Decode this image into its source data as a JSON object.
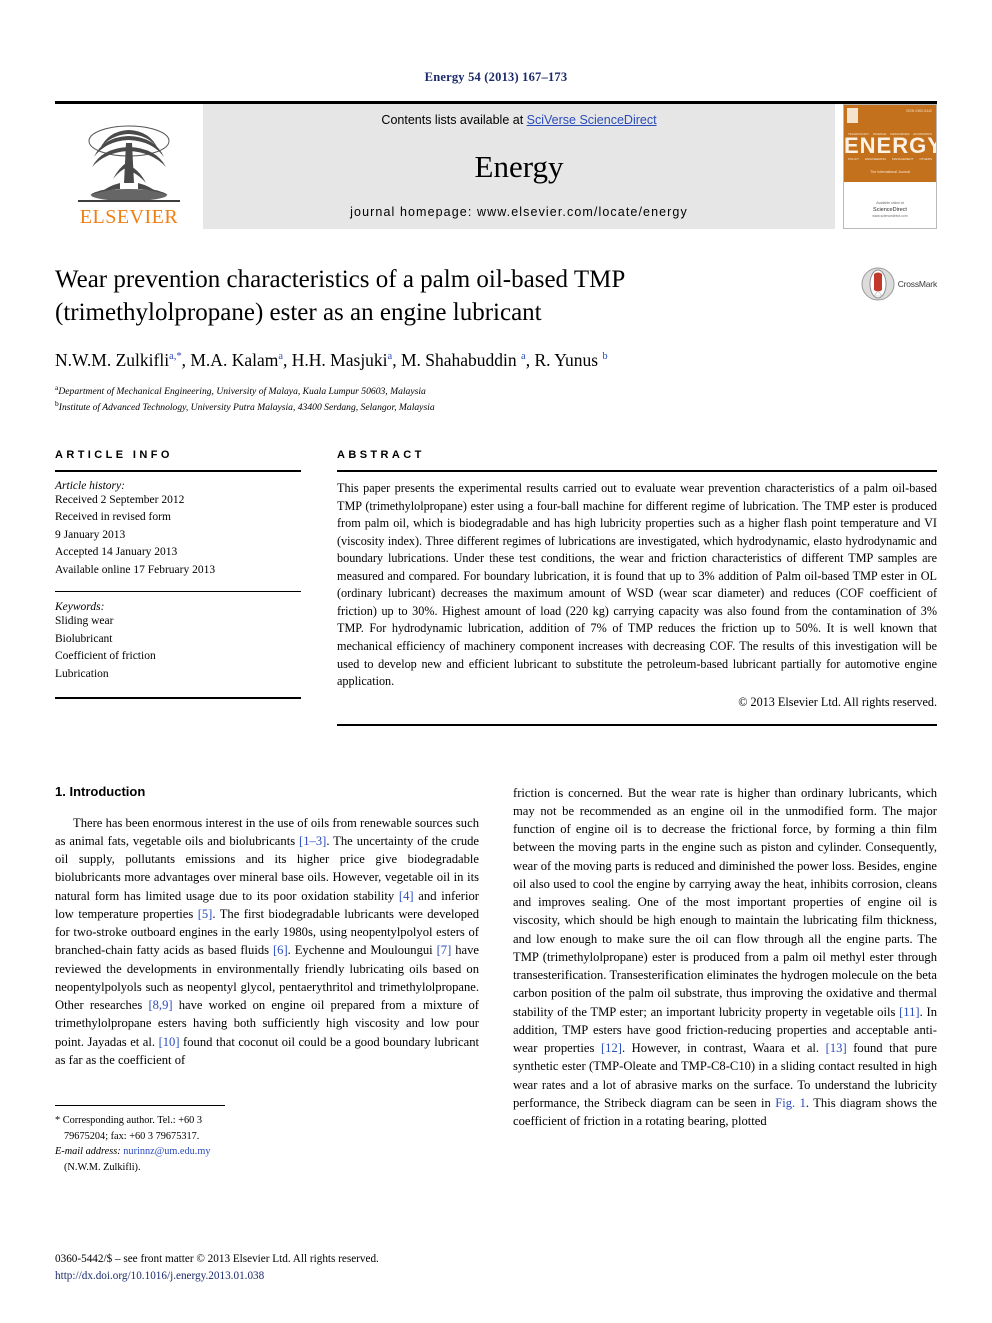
{
  "running_head": "Energy 54 (2013) 167–173",
  "banner": {
    "publisher": "ELSEVIER",
    "contents_prefix": "Contents lists available at ",
    "contents_link": "SciVerse ScienceDirect",
    "journal_name": "Energy",
    "homepage": "journal homepage: www.elsevier.com/locate/energy",
    "cover": {
      "title": "ENERGY",
      "code": "ISSN 0360-5442",
      "subtitle": "The International Journal",
      "keywords_row1": [
        "TECHNOLOGY",
        "SCIENCE",
        "RESOURCES",
        "ECONOMICS"
      ],
      "keywords_row2": [
        "POLICY",
        "ENGINEERING",
        "MANAGEMENT",
        "OTHERS"
      ],
      "sd_small": "Available online at",
      "sd_big": "ScienceDirect",
      "sd_url": "www.sciencedirect.com"
    },
    "link_color": "#2a4bbd"
  },
  "article": {
    "title": "Wear prevention characteristics of a palm oil-based TMP (trimethylolpropane) ester as an engine lubricant",
    "authors_html": "N.W.M. Zulkifli<sup class=\"aff-mark\">a,*</sup>, M.A. Kalam<sup class=\"aff-mark\">a</sup>, H.H. Masjuki<sup class=\"aff-mark\">a</sup>, M. Shahabuddin <sup class=\"aff-mark\">a</sup>, R. Yunus <sup class=\"aff-mark\">b</sup>",
    "affiliation_a": "Department of Mechanical Engineering, University of Malaya, Kuala Lumpur 50603, Malaysia",
    "affiliation_b": "Institute of Advanced Technology, University Putra Malaysia, 43400 Serdang, Selangor, Malaysia",
    "crossmark_label": "CrossMark"
  },
  "article_info": {
    "heading": "ARTICLE INFO",
    "history_label": "Article history:",
    "history": [
      "Received 2 September 2012",
      "Received in revised form",
      "9 January 2013",
      "Accepted 14 January 2013",
      "Available online 17 February 2013"
    ],
    "keywords_label": "Keywords:",
    "keywords": [
      "Sliding wear",
      "Biolubricant",
      "Coefficient of friction",
      "Lubrication"
    ]
  },
  "abstract": {
    "heading": "ABSTRACT",
    "text": "This paper presents the experimental results carried out to evaluate wear prevention characteristics of a palm oil-based TMP (trimethylolpropane) ester using a four-ball machine for different regime of lubrication. The TMP ester is produced from palm oil, which is biodegradable and has high lubricity properties such as a higher flash point temperature and VI (viscosity index). Three different regimes of lubrications are investigated, which hydrodynamic, elasto hydrodynamic and boundary lubrications. Under these test conditions, the wear and friction characteristics of different TMP samples are measured and compared. For boundary lubrication, it is found that up to 3% addition of Palm oil-based TMP ester in OL (ordinary lubricant) decreases the maximum amount of WSD (wear scar diameter) and reduces (COF coefficient of friction) up to 30%. Highest amount of load (220 kg) carrying capacity was also found from the contamination of 3% TMP. For hydrodynamic lubrication, addition of 7% of TMP reduces the friction up to 50%. It is well known that mechanical efficiency of machinery component increases with decreasing COF. The results of this investigation will be used to develop new and efficient lubricant to substitute the petroleum-based lubricant partially for automotive engine application.",
    "copyright": "© 2013 Elsevier Ltd. All rights reserved."
  },
  "introduction": {
    "heading": "1. Introduction",
    "left_paragraph_html": "There has been enormous interest in the use of oils from renewable sources such as animal fats, vegetable oils and biolubricants <span class=\"ref\">[1–3]</span>. The uncertainty of the crude oil supply, pollutants emissions and its higher price give biodegradable biolubricants more advantages over mineral base oils. However, vegetable oil in its natural form has limited usage due to its poor oxidation stability <span class=\"ref\">[4]</span> and inferior low temperature properties <span class=\"ref\">[5]</span>. The first biodegradable lubricants were developed for two-stroke outboard engines in the early 1980s, using neopentylpolyol esters of branched-chain fatty acids as based fluids <span class=\"ref\">[6]</span>. Eychenne and Mouloungui <span class=\"ref\">[7]</span> have reviewed the developments in environmentally friendly lubricating oils based on neopentylpolyols such as neopentyl glycol, pentaerythritol and trimethylolpropane. Other researches <span class=\"ref\">[8,9]</span> have worked on engine oil prepared from a mixture of trimethylolpropane esters having both sufficiently high viscosity and low pour point. Jayadas et al. <span class=\"ref\">[10]</span> found that coconut oil could be a good boundary lubricant as far as the coefficient of",
    "right_paragraph_html": "friction is concerned. But the wear rate is higher than ordinary lubricants, which may not be recommended as an engine oil in the unmodified form. The major function of engine oil is to decrease the frictional force, by forming a thin film between the moving parts in the engine such as piston and cylinder. Consequently, wear of the moving parts is reduced and diminished the power loss. Besides, engine oil also used to cool the engine by carrying away the heat, inhibits corrosion, cleans and improves sealing. One of the most important properties of engine oil is viscosity, which should be high enough to maintain the lubricating film thickness, and low enough to make sure the oil can flow through all the engine parts. The TMP (trimethylolpropane) ester is produced from a palm oil methyl ester through transesterification. Transesterification eliminates the hydrogen molecule on the beta carbon position of the palm oil substrate, thus improving the oxidative and thermal stability of the TMP ester; an important lubricity property in vegetable oils <span class=\"ref\">[11]</span>. In addition, TMP esters have good friction-reducing properties and acceptable anti-wear properties <span class=\"ref\">[12]</span>. However, in contrast, Waara et al. <span class=\"ref\">[13]</span> found that pure synthetic ester (TMP-Oleate and TMP-C8-C10) in a sliding contact resulted in high wear rates and a lot of abrasive marks on the surface. To understand the lubricity performance, the Stribeck diagram can be seen in <span class=\"ref\">Fig. 1</span>. This diagram shows the coefficient of friction in a rotating bearing, plotted"
  },
  "footnote": {
    "corresponding_html": "* Corresponding author. Tel.: +60 3 79675204; fax: +60 3 79675317.",
    "email_html": "<i>E-mail address:</i> <span class=\"email\">nurinnz@um.edu.my</span> (N.W.M. Zulkifli)."
  },
  "page_footer": {
    "front_matter": "0360-5442/$ – see front matter © 2013 Elsevier Ltd. All rights reserved.",
    "doi": "http://dx.doi.org/10.1016/j.energy.2013.01.038"
  }
}
